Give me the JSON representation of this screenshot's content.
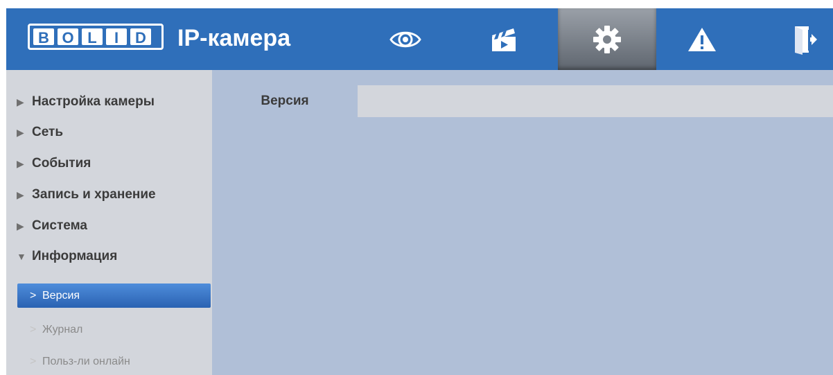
{
  "header": {
    "logo_letters": [
      "B",
      "O",
      "L",
      "I",
      "D"
    ],
    "app_title": "IP-камера",
    "nav": [
      {
        "name": "live-view",
        "icon": "eye-icon"
      },
      {
        "name": "playback",
        "icon": "clapperboard-icon"
      },
      {
        "name": "settings",
        "icon": "gear-icon",
        "active": true
      },
      {
        "name": "alarm",
        "icon": "warning-icon"
      },
      {
        "name": "logout",
        "icon": "exit-door-icon"
      }
    ]
  },
  "sidebar": {
    "items": [
      {
        "label": "Настройка камеры",
        "expanded": false
      },
      {
        "label": "Сеть",
        "expanded": false
      },
      {
        "label": "События",
        "expanded": false
      },
      {
        "label": "Запись и хранение",
        "expanded": false
      },
      {
        "label": "Система",
        "expanded": false
      },
      {
        "label": "Информация",
        "expanded": true
      }
    ],
    "sub_items": [
      {
        "label": "Версия",
        "active": true
      },
      {
        "label": "Журнал",
        "active": false
      },
      {
        "label": "Польз-ли онлайн",
        "active": false
      }
    ]
  },
  "main": {
    "tabs": [
      {
        "label": "Версия"
      }
    ]
  },
  "colors": {
    "header_bg": "#2f6fba",
    "sidebar_bg": "#d3d6dc",
    "content_bg": "#b0bfd7",
    "active_item": "#3a75c8"
  }
}
